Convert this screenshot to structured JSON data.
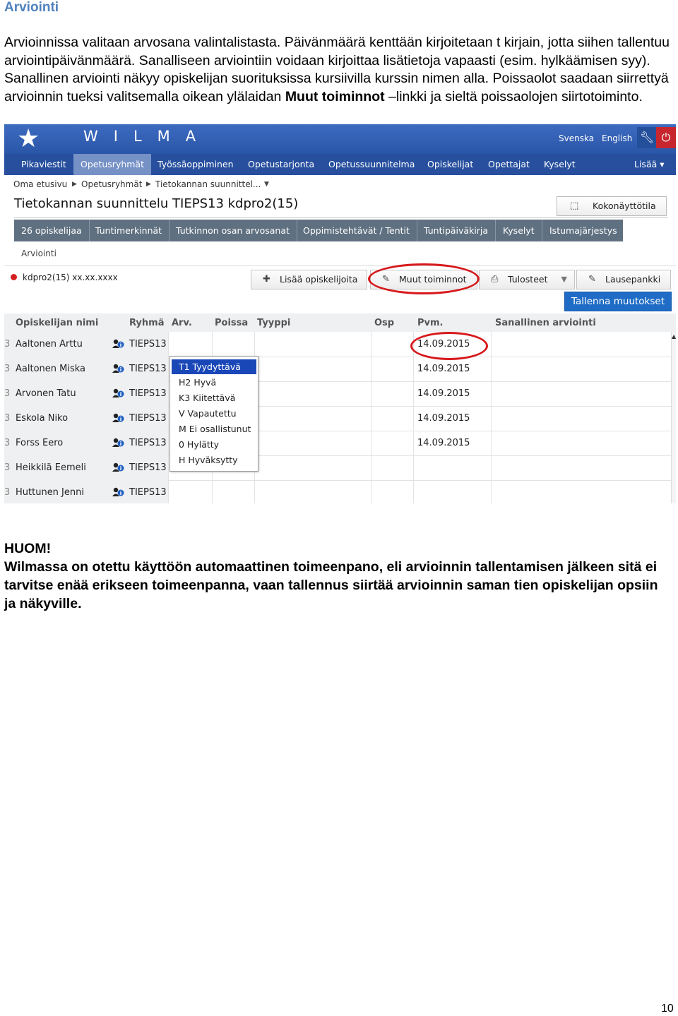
{
  "document": {
    "title": "Arviointi",
    "intro_part1": "Arvioinnissa valitaan arvosana valintalistasta. Päivänmäärä kenttään kirjoitetaan t kirjain, jotta siihen tallentuu arviointipäivänmäärä. Sanalliseen arviointiin voidaan kirjoittaa lisätietoja vapaasti (esim. hylkäämisen syy). Sanallinen arviointi näkyy opiskelijan suorituksissa kursiivilla kurssin nimen alla. Poissaolot saadaan siirrettyä arvioinnin tueksi valitsemalla oikean ylälaidan ",
    "intro_bold": "Muut toiminnot",
    "intro_part2": " –linkki ja sieltä poissaolojen siirtotoiminto.",
    "note_heading": "HUOM!",
    "note_text": "Wilmassa on otettu käyttöön automaattinen toimeenpano, eli arvioinnin tallentamisen jälkeen sitä ei tarvitse enää erikseen toimeenpanna, vaan tallennus siirtää arvioinnin saman tien opiskelijan opsiin ja näkyville.",
    "page_number": "10"
  },
  "wilma": {
    "logo_text": "WILMA",
    "logo_icon": "star-logo",
    "lang_sv": "Svenska",
    "lang_en": "English",
    "nav": [
      "Pikaviestit",
      "Opetusryhmät",
      "Työssäoppiminen",
      "Opetustarjonta",
      "Opetussuunnitelma",
      "Opiskelijat",
      "Opettajat",
      "Kyselyt"
    ],
    "nav_more": "Lisää",
    "breadcrumb": [
      "Oma etusivu",
      "Opetusryhmät",
      "Tietokannan suunnittel..."
    ],
    "course_title": "Tietokannan suunnittelu TIEPS13 kdpro2(15)",
    "fullscreen_label": "Kokonäyttötila",
    "tabs": [
      "26 opiskelijaa",
      "Tuntimerkinnät",
      "Tutkinnon osan arvosanat",
      "Oppimistehtävät / Tentit",
      "Tuntipäiväkirja",
      "Kyselyt",
      "Istumajärjestys"
    ],
    "subtab": "Arviointi",
    "record_label": "kdpro2(15) xx.xx.xxxx",
    "buttons": {
      "add_students": "Lisää opiskelijoita",
      "other_actions": "Muut toiminnot",
      "prints": "Tulosteet",
      "phrase_bank": "Lausepankki",
      "save": "Tallenna muutokset"
    },
    "headers": {
      "name": "Opiskelijan nimi",
      "group": "Ryhmä",
      "grade": "Arv.",
      "absent": "Poissa",
      "type": "Tyyppi",
      "osp": "Osp",
      "date": "Pvm.",
      "verbal": "Sanallinen arviointi"
    },
    "rows": [
      {
        "num": "3",
        "name": "Aaltonen Arttu",
        "group": "TIEPS13",
        "date": "14.09.2015"
      },
      {
        "num": "3",
        "name": "Aaltonen Miska",
        "group": "TIEPS13",
        "date": "14.09.2015"
      },
      {
        "num": "3",
        "name": "Arvonen Tatu",
        "group": "TIEPS13",
        "date": "14.09.2015"
      },
      {
        "num": "3",
        "name": "Eskola Niko",
        "group": "TIEPS13",
        "date": "14.09.2015"
      },
      {
        "num": "3",
        "name": "Forss Eero",
        "group": "TIEPS13",
        "date": "14.09.2015"
      },
      {
        "num": "3",
        "name": "Heikkilä Eemeli",
        "group": "TIEPS13",
        "date": ""
      },
      {
        "num": "3",
        "name": "Huttunen Jenni",
        "group": "TIEPS13",
        "date": ""
      }
    ],
    "grade_options": [
      "T1 Tyydyttävä",
      "H2 Hyvä",
      "K3 Kiitettävä",
      "V Vapautettu",
      "M Ei osallistunut",
      "0 Hylätty",
      "H Hyväksytty"
    ],
    "selected_grade": "T1 Tyydyttävä",
    "colors": {
      "topbar": "#2a56a8",
      "navbar": "#274f9e",
      "tabbar": "#5f7080",
      "save_button": "#1f6cc6",
      "highlight_ring": "#d7191c",
      "selected_option": "#1a47b8"
    }
  }
}
